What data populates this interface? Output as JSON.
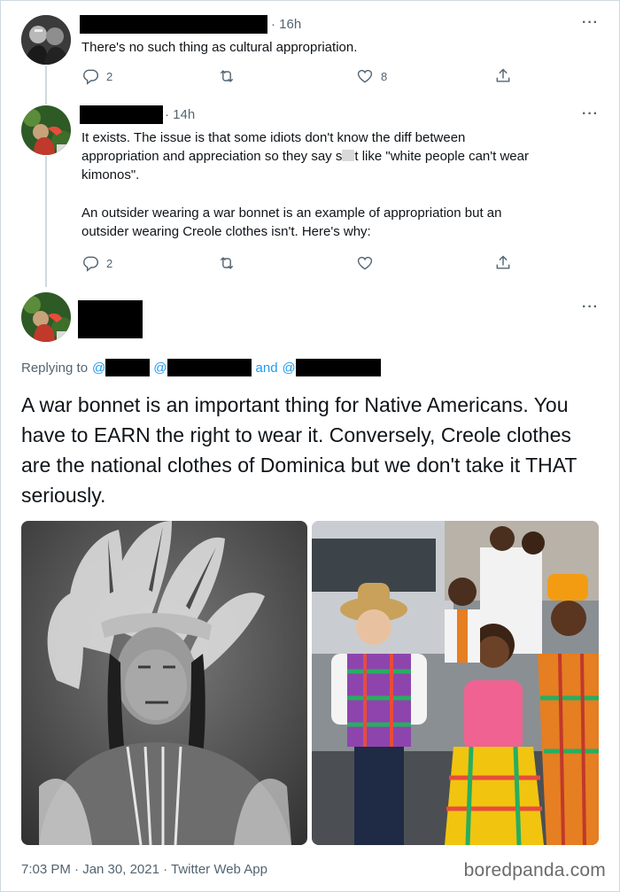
{
  "tweets": [
    {
      "time": "· 16h",
      "lines": [
        "There's no such thing as cultural appropriation."
      ],
      "replies": "2",
      "likes": "8"
    },
    {
      "time": "· 14h",
      "line1": "It exists. The issue is that some idiots don't know the diff between",
      "line2_pre": "appropriation and appreciation so they say s",
      "line2_post": "t like \"white people can't wear",
      "line3": "kimonos\".",
      "line4": "An outsider wearing a war bonnet is an example of appropriation but an",
      "line5": "outsider wearing Creole clothes isn't. Here's why:",
      "replies": "2"
    }
  ],
  "main": {
    "replying_label": "Replying to",
    "at1": "@",
    "at2": "@",
    "and": "and",
    "at3": "@",
    "text": "A war bonnet is an important thing for Native Americans. You have to EARN the right to wear it. Conversely, Creole clothes are the national clothes of Dominica but we don't take it THAT seriously.",
    "timestamp": "7:03 PM · Jan 30, 2021 · Twitter Web App"
  },
  "watermark": "boredpanda.com",
  "icons": {
    "reply": "reply-icon",
    "retweet": "retweet-icon",
    "like": "heart-icon",
    "share": "share-icon",
    "more": "more-icon"
  },
  "colors": {
    "link": "#1d9bf0",
    "secondary_text": "#536471",
    "divider": "#e1e8ed"
  }
}
